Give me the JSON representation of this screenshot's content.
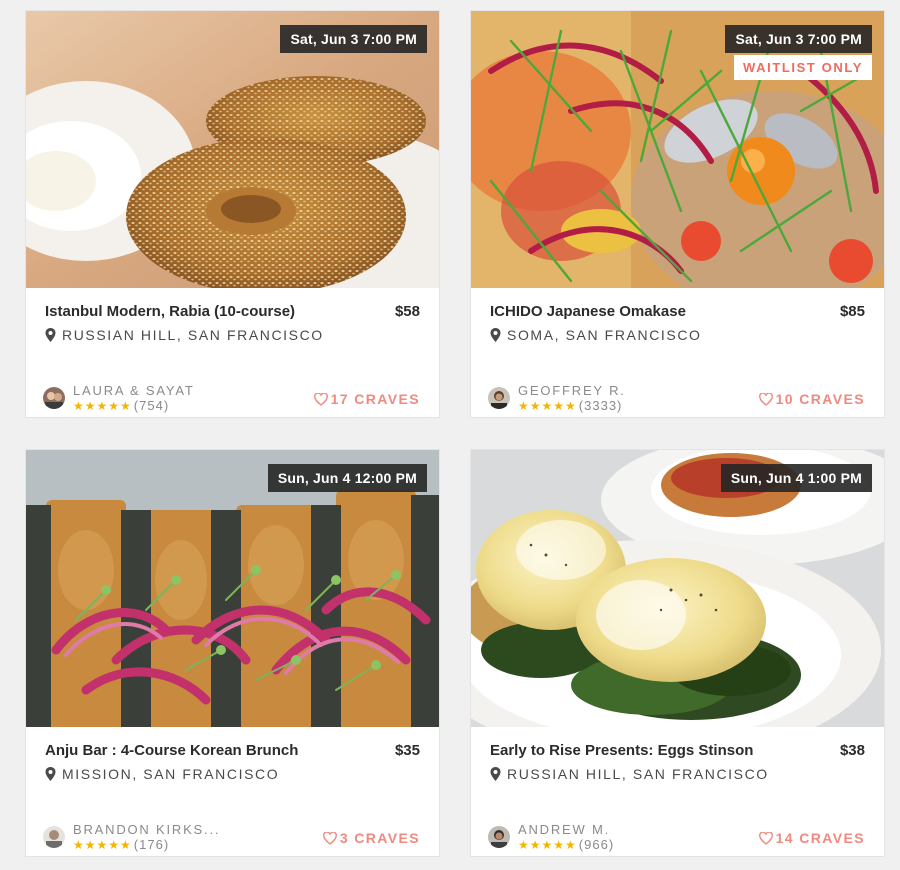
{
  "listings": [
    {
      "date": "Sat, Jun 3 7:00 PM",
      "badge": "",
      "title": "Istanbul Modern, Rabia (10-course)",
      "price": "$58",
      "location": "RUSSIAN HILL, SAN FRANCISCO",
      "host": "LAURA & SAYAT",
      "rating": 5,
      "review_count": "(754)",
      "craves": "17 CRAVES",
      "photo_subject": "sesame bread ring (simit)"
    },
    {
      "date": "Sat, Jun 3 7:00 PM",
      "badge": "WAITLIST ONLY",
      "title": "ICHIDO Japanese Omakase",
      "price": "$85",
      "location": "SOMA, SAN FRANCISCO",
      "host": "GEOFFREY R.",
      "rating": 5,
      "review_count": "(3333)",
      "craves": "10 CRAVES",
      "photo_subject": "colorful fish and vegetable salad"
    },
    {
      "date": "Sun, Jun 4 12:00 PM",
      "badge": "",
      "title": "Anju Bar : 4-Course Korean Brunch",
      "price": "$35",
      "location": "MISSION, SAN FRANCISCO",
      "host": "BRANDON KIRKS...",
      "rating": 5,
      "review_count": "(176)",
      "craves": "3 CRAVES",
      "photo_subject": "pancake with pickled red onions and microgreens"
    },
    {
      "date": "Sun, Jun 4 1:00 PM",
      "badge": "",
      "title": "Early to Rise Presents: Eggs Stinson",
      "price": "$38",
      "location": "RUSSIAN HILL, SAN FRANCISCO",
      "host": "ANDREW M.",
      "rating": 5,
      "review_count": "(966)",
      "craves": "14 CRAVES",
      "photo_subject": "poached eggs with hollandaise on greens"
    }
  ],
  "stars_text": "★★★★★",
  "colors": {
    "accent": "#ef6b5f",
    "craves": "#ef8a7f",
    "star": "#f5b400",
    "badge_bg": "#262626"
  }
}
